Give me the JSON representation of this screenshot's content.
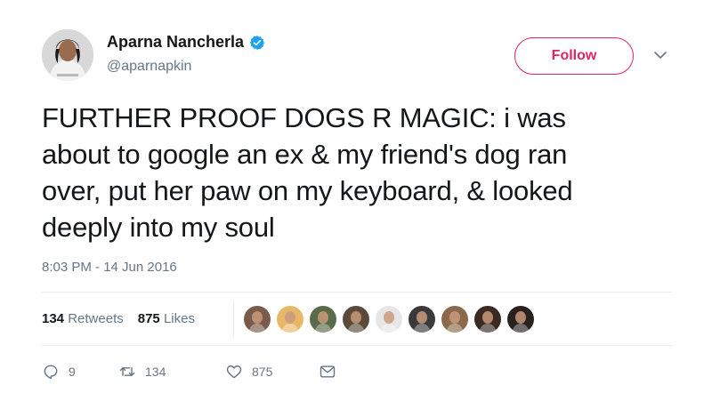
{
  "author": {
    "display_name": "Aparna Nancherla",
    "handle": "@aparnapkin",
    "verified": true
  },
  "header": {
    "follow_label": "Follow",
    "accent_color": "#e0245e"
  },
  "tweet": {
    "lines": [
      "FURTHER PROOF DOGS R MAGIC: i was",
      "about to google an ex & my friend's dog ran",
      "over, put her paw on my keyboard, & looked",
      "deeply into my soul"
    ],
    "timestamp": "8:03 PM - 14 Jun 2016"
  },
  "stats": {
    "retweets_count": "134",
    "retweets_label": "Retweets",
    "likes_count": "875",
    "likes_label": "Likes"
  },
  "likers": [
    {
      "name": "liker-avatar-1",
      "color": "#7a5a48"
    },
    {
      "name": "liker-avatar-2",
      "color": "#e8b86a"
    },
    {
      "name": "liker-avatar-3",
      "color": "#5a6b4a"
    },
    {
      "name": "liker-avatar-4",
      "color": "#5b4a3a"
    },
    {
      "name": "liker-avatar-5",
      "color": "#e6e6e6"
    },
    {
      "name": "liker-avatar-6",
      "color": "#3a3a3a"
    },
    {
      "name": "liker-avatar-7",
      "color": "#8a6a4a"
    },
    {
      "name": "liker-avatar-8",
      "color": "#3a2a22"
    },
    {
      "name": "liker-avatar-9",
      "color": "#2a2020"
    }
  ],
  "actions": {
    "reply_count": "9",
    "retweet_count": "134",
    "like_count": "875",
    "icons": [
      "reply-icon",
      "retweet-icon",
      "like-icon",
      "message-icon"
    ]
  }
}
